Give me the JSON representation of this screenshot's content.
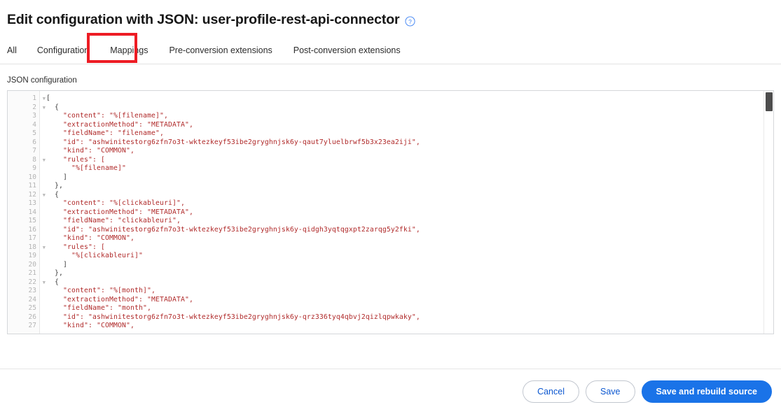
{
  "header": {
    "title": "Edit configuration with JSON: user-profile-rest-api-connector",
    "help_icon": "help-circle-icon"
  },
  "tabs": [
    {
      "label": "All",
      "name": "tab-all"
    },
    {
      "label": "Configuration",
      "name": "tab-configuration"
    },
    {
      "label": "Mappings",
      "name": "tab-mappings"
    },
    {
      "label": "Pre-conversion extensions",
      "name": "tab-pre-conversion-extensions"
    },
    {
      "label": "Post-conversion extensions",
      "name": "tab-post-conversion-extensions"
    }
  ],
  "annotation": {
    "target": "Mappings",
    "color": "#ed1c24"
  },
  "editor": {
    "label": "JSON configuration",
    "first_visible_line": 1,
    "last_visible_line": 27,
    "fold_lines": [
      1,
      2,
      8,
      12,
      18,
      22
    ],
    "lines": [
      "[",
      "  {",
      "    \"content\": \"%[filename]\",",
      "    \"extractionMethod\": \"METADATA\",",
      "    \"fieldName\": \"filename\",",
      "    \"id\": \"ashwinitestorg6zfn7o3t-wktezkeyf53ibe2gryghnjsk6y-qaut7yluelbrwf5b3x23ea2iji\",",
      "    \"kind\": \"COMMON\",",
      "    \"rules\": [",
      "      \"%[filename]\"",
      "    ]",
      "  },",
      "  {",
      "    \"content\": \"%[clickableuri]\",",
      "    \"extractionMethod\": \"METADATA\",",
      "    \"fieldName\": \"clickableuri\",",
      "    \"id\": \"ashwinitestorg6zfn7o3t-wktezkeyf53ibe2gryghnjsk6y-qidgh3yqtqgxpt2zarqg5y2fki\",",
      "    \"kind\": \"COMMON\",",
      "    \"rules\": [",
      "      \"%[clickableuri]\"",
      "    ]",
      "  },",
      "  {",
      "    \"content\": \"%[month]\",",
      "    \"extractionMethod\": \"METADATA\",",
      "    \"fieldName\": \"month\",",
      "    \"id\": \"ashwinitestorg6zfn7o3t-wktezkeyf53ibe2gryghnjsk6y-qrz336tyq4qbvj2qizlqpwkaky\",",
      "    \"kind\": \"COMMON\","
    ],
    "scrollbar": "vertical-scrollbar"
  },
  "footer": {
    "cancel_label": "Cancel",
    "save_label": "Save",
    "save_rebuild_label": "Save and rebuild source",
    "primary_color": "#1a73e8"
  }
}
